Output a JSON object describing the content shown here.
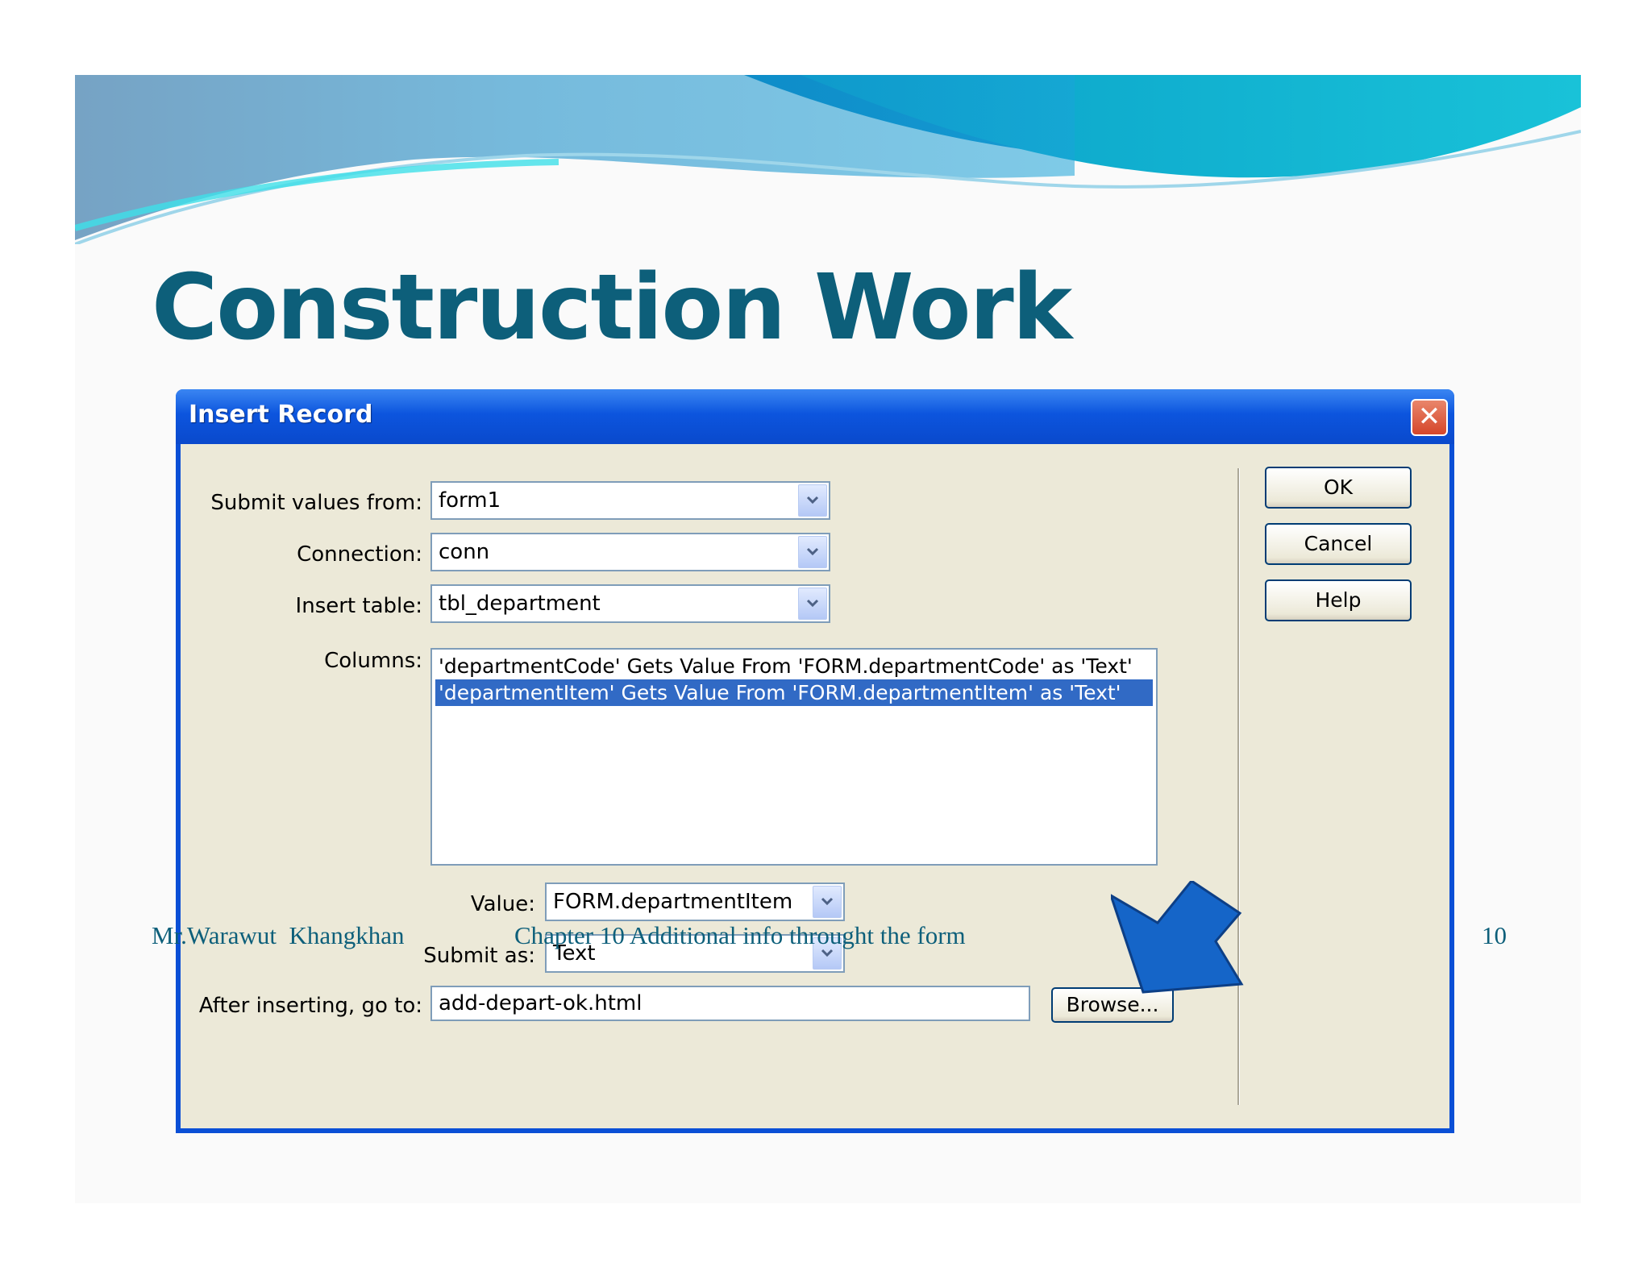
{
  "slide": {
    "title": "Construction Work",
    "footer_author": "Mr.Warawut  Khangkhan",
    "footer_chapter": "Chapter 10 Additional info throught the form",
    "page_number": "10"
  },
  "dialog": {
    "title": "Insert Record",
    "fields": {
      "submit_values_from": {
        "label": "Submit values from:",
        "value": "form1"
      },
      "connection": {
        "label": "Connection:",
        "value": "conn"
      },
      "insert_table": {
        "label": "Insert table:",
        "value": "tbl_department"
      },
      "columns": {
        "label": "Columns:",
        "items": [
          {
            "text": "'departmentCode' Gets Value From 'FORM.departmentCode' as 'Text'",
            "selected": false
          },
          {
            "text": "'departmentItem' Gets Value From 'FORM.departmentItem' as 'Text'",
            "selected": true
          }
        ]
      },
      "value": {
        "label": "Value:",
        "value": "FORM.departmentItem"
      },
      "submit_as": {
        "label": "Submit as:",
        "value": "Text"
      },
      "after_inserting": {
        "label": "After inserting, go to:",
        "value": "add-depart-ok.html"
      }
    },
    "buttons": {
      "ok": "OK",
      "cancel": "Cancel",
      "help": "Help",
      "browse": "Browse..."
    }
  },
  "colors": {
    "title_text": "#0d5f7a",
    "dialog_frame": "#0a4fd6",
    "selection": "#316ac5",
    "pointer_arrow": "#1565c8"
  }
}
